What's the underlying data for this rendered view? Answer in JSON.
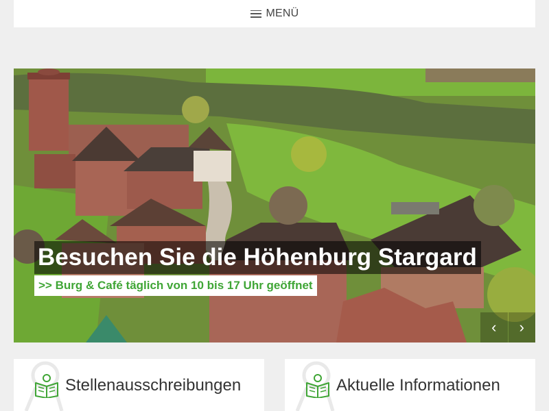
{
  "header": {
    "menu_label": "MENÜ",
    "menu_icon": "hamburger-icon"
  },
  "hero": {
    "title": "Besuchen Sie die Höhenburg Stargard",
    "subtitle": ">> Burg & Café täglich von 10 bis 17 Uhr geöffnet",
    "prev_label": "‹",
    "next_label": "›"
  },
  "cards": [
    {
      "title": "Stellenausschreibungen",
      "icon": "book-reader-icon"
    },
    {
      "title": "Aktuelle Informationen",
      "icon": "book-reader-icon"
    }
  ],
  "colors": {
    "accent": "#3fa535",
    "background": "#efefef"
  }
}
